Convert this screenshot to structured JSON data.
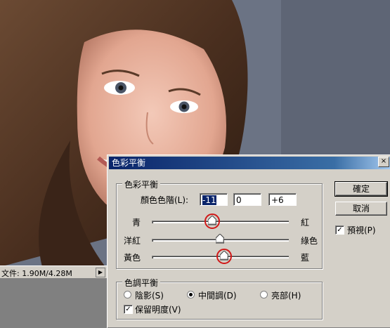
{
  "status": {
    "doc_size": "文件: 1.90M/4.28M"
  },
  "dialog": {
    "title": "色彩平衡",
    "close": "×",
    "balance_group": {
      "legend": "色彩平衡",
      "levels_label": "顏色色階(L):",
      "levels": [
        "-11",
        "0",
        "+6"
      ],
      "sliders": [
        {
          "left": "青",
          "right": "紅",
          "value": -11
        },
        {
          "left": "洋紅",
          "right": "綠色",
          "value": 0
        },
        {
          "left": "黃色",
          "right": "藍",
          "value": 6
        }
      ],
      "range": [
        -100,
        100
      ]
    },
    "tone_group": {
      "legend": "色調平衡",
      "options": [
        "陰影(S)",
        "中間調(D)",
        "亮部(H)"
      ],
      "selected": "中間調(D)",
      "preserve_label": "保留明度(V)",
      "preserve_checked": true
    },
    "buttons": {
      "ok": "確定",
      "cancel": "取消"
    },
    "preview_label": "預視(P)",
    "preview_checked": true
  }
}
